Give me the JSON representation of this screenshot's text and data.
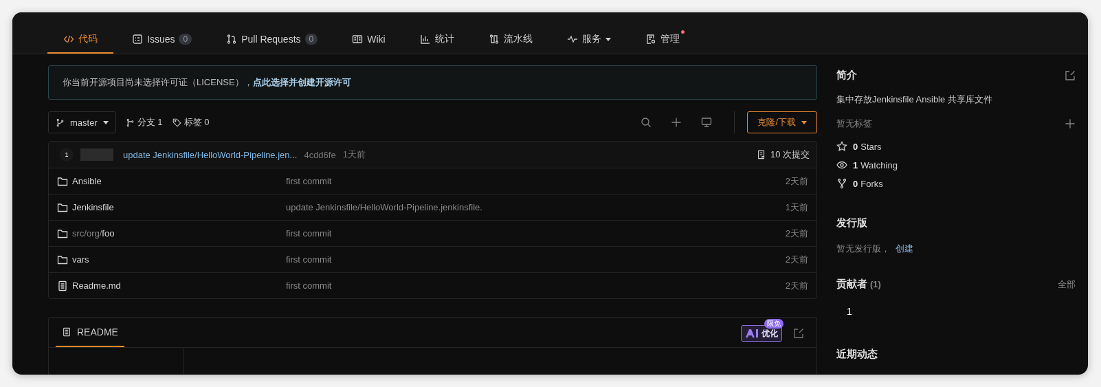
{
  "tabs": [
    {
      "label": "代码",
      "selected": true
    },
    {
      "label": "Issues",
      "count": "0",
      "selected": false
    },
    {
      "label": "Pull Requests",
      "count": "0",
      "selected": false
    },
    {
      "label": "Wiki",
      "selected": false
    },
    {
      "label": "统计",
      "selected": false
    },
    {
      "label": "流水线",
      "selected": false
    },
    {
      "label": "服务",
      "dropdown": true,
      "selected": false
    },
    {
      "label": "管理",
      "notification": true,
      "selected": false
    }
  ],
  "notice": {
    "text": "你当前开源项目尚未选择许可证（LICENSE），",
    "link": "点此选择并创建开源许可"
  },
  "branch_bar": {
    "branch": "master",
    "branches": "分支 1",
    "tags": "标签 0",
    "clone_button": "克隆/下载"
  },
  "last_commit": {
    "avatar": "1",
    "author_redacted": true,
    "message": "update Jenkinsfile/HelloWorld-Pipeline.jen...",
    "hash": "4cdd6fe",
    "time": "1天前",
    "commits": "10 次提交"
  },
  "files": [
    {
      "kind": "folder",
      "name": "Ansible",
      "message": "first commit",
      "time": "2天前"
    },
    {
      "kind": "folder",
      "name": "Jenkinsfile",
      "message": "update Jenkinsfile/HelloWorld-Pipeline.jenkinsfile.",
      "time": "1天前"
    },
    {
      "kind": "folder",
      "path": "src/org/",
      "name": "foo",
      "message": "first commit",
      "time": "2天前"
    },
    {
      "kind": "folder",
      "name": "vars",
      "message": "first commit",
      "time": "2天前"
    },
    {
      "kind": "file",
      "name": "Readme.md",
      "message": "first commit",
      "time": "2天前"
    }
  ],
  "readme": {
    "tab": "README",
    "ai_button": "优化",
    "ai_badge": "限免"
  },
  "sidebar": {
    "intro_title": "简介",
    "description": "集中存放Jenkinsfile Ansible 共享库文件",
    "no_tags": "暂无标签",
    "stats": [
      {
        "kind": "stars",
        "count": "0",
        "label": "Stars"
      },
      {
        "kind": "watching",
        "count": "1",
        "label": "Watching"
      },
      {
        "kind": "forks",
        "count": "0",
        "label": "Forks"
      }
    ],
    "releases_title": "发行版",
    "no_releases": "暂无发行版，",
    "create_link": "创建",
    "contributors_title": "贡献者",
    "contributors_count": "(1)",
    "all_link": "全部",
    "contributor_avatar": "1",
    "activity_title": "近期动态"
  }
}
